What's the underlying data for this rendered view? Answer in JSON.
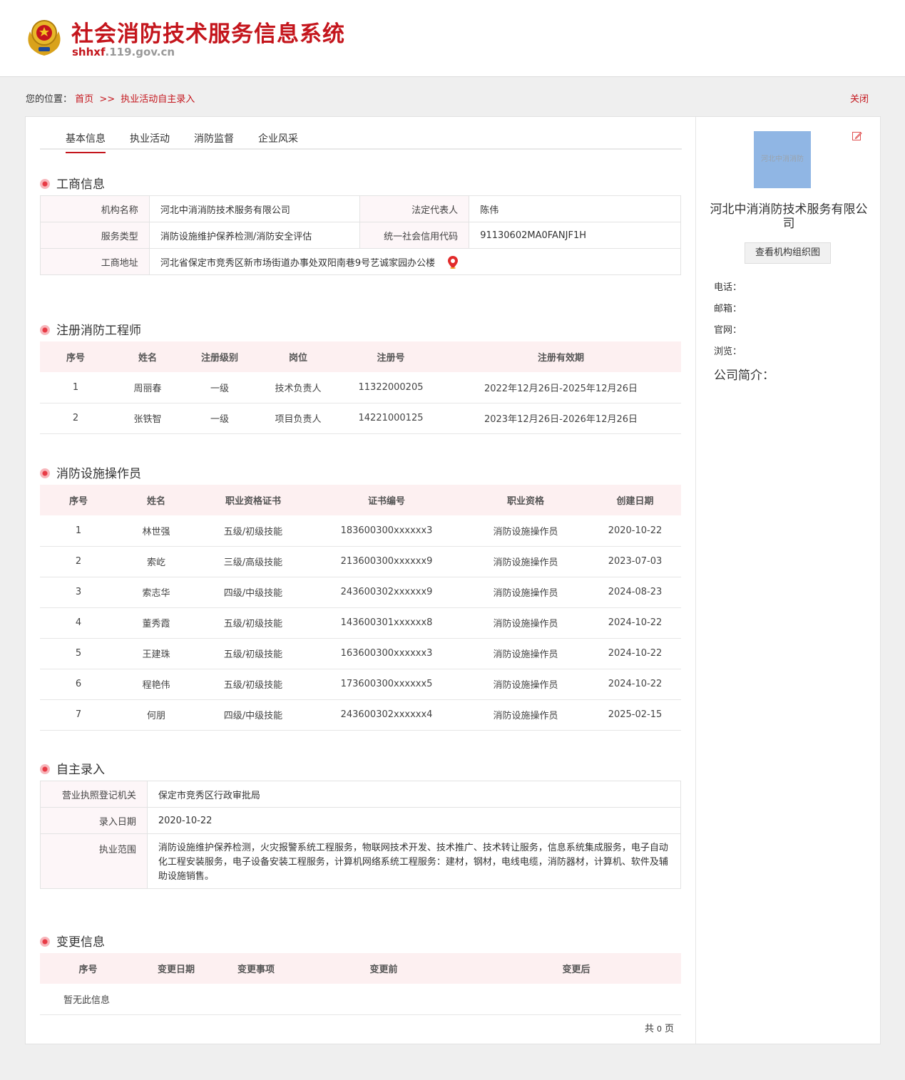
{
  "header": {
    "title": "社会消防技术服务信息系统",
    "domain_prefix": "shhxf",
    "domain_suffix": ".119.gov.cn"
  },
  "breadcrumb": {
    "label": "您的位置：",
    "home": "首页",
    "sep": ">>",
    "current": "执业活动自主录入"
  },
  "close_label": "关闭",
  "tabs": [
    "基本信息",
    "执业活动",
    "消防监督",
    "企业风采"
  ],
  "business": {
    "title": "工商信息",
    "name_label": "机构名称",
    "name": "河北中消消防技术服务有限公司",
    "rep_label": "法定代表人",
    "rep": "陈伟",
    "type_label": "服务类型",
    "type": "消防设施维护保养检测/消防安全评估",
    "code_label": "统一社会信用代码",
    "code": "91130602MA0FANJF1H",
    "addr_label": "工商地址",
    "addr": "河北省保定市竞秀区新市场街道办事处双阳南巷9号艺诚家园办公楼"
  },
  "engineers": {
    "title": "注册消防工程师",
    "headers": [
      "序号",
      "姓名",
      "注册级别",
      "岗位",
      "注册号",
      "注册有效期"
    ],
    "rows": [
      [
        "1",
        "周丽春",
        "一级",
        "技术负责人",
        "11322000205",
        "2022年12月26日-2025年12月26日"
      ],
      [
        "2",
        "张铁智",
        "一级",
        "项目负责人",
        "14221000125",
        "2023年12月26日-2026年12月26日"
      ]
    ]
  },
  "operators": {
    "title": "消防设施操作员",
    "headers": [
      "序号",
      "姓名",
      "职业资格证书",
      "证书编号",
      "职业资格",
      "创建日期"
    ],
    "rows": [
      [
        "1",
        "林世强",
        "五级/初级技能",
        "183600300xxxxxx3",
        "消防设施操作员",
        "2020-10-22"
      ],
      [
        "2",
        "索屹",
        "三级/高级技能",
        "213600300xxxxxx9",
        "消防设施操作员",
        "2023-07-03"
      ],
      [
        "3",
        "索志华",
        "四级/中级技能",
        "243600302xxxxxx9",
        "消防设施操作员",
        "2024-08-23"
      ],
      [
        "4",
        "董秀霞",
        "五级/初级技能",
        "143600301xxxxxx8",
        "消防设施操作员",
        "2024-10-22"
      ],
      [
        "5",
        "王建珠",
        "五级/初级技能",
        "163600300xxxxxx3",
        "消防设施操作员",
        "2024-10-22"
      ],
      [
        "6",
        "程艳伟",
        "五级/初级技能",
        "173600300xxxxxx5",
        "消防设施操作员",
        "2024-10-22"
      ],
      [
        "7",
        "何朋",
        "四级/中级技能",
        "243600302xxxxxx4",
        "消防设施操作员",
        "2025-02-15"
      ]
    ]
  },
  "self_entry": {
    "title": "自主录入",
    "authority_label": "营业执照登记机关",
    "authority": "保定市竞秀区行政审批局",
    "date_label": "录入日期",
    "date": "2020-10-22",
    "scope_label": "执业范围",
    "scope": "消防设施维护保养检测，火灾报警系统工程服务，物联网技术开发、技术推广、技术转让服务，信息系统集成服务，电子自动化工程安装服务，电子设备安装工程服务，计算机网络系统工程服务：建材，钢材，电线电缆，消防器材，计算机、软件及辅助设施销售。"
  },
  "changes": {
    "title": "变更信息",
    "headers": [
      "序号",
      "变更日期",
      "变更事项",
      "变更前",
      "变更后"
    ],
    "empty": "暂无此信息"
  },
  "pager": {
    "prefix": "共",
    "count": "0",
    "suffix": "页"
  },
  "side": {
    "logo_text": "河北中消消防",
    "org_name": "河北中消消防技术服务有限公司",
    "org_chart_button": "查看机构组织图",
    "phone_label": "电话：",
    "email_label": "邮箱：",
    "website_label": "官网：",
    "views_label": "浏览：",
    "intro_label": "公司简介："
  },
  "colors": {
    "brand": "#c4151c",
    "header_bg": "#fdf0f1",
    "label_bg": "#fdf6f8"
  },
  "icons": {
    "emblem": "fire-rescue-emblem-icon",
    "location": "map-pin-icon",
    "edit": "edit-icon"
  }
}
